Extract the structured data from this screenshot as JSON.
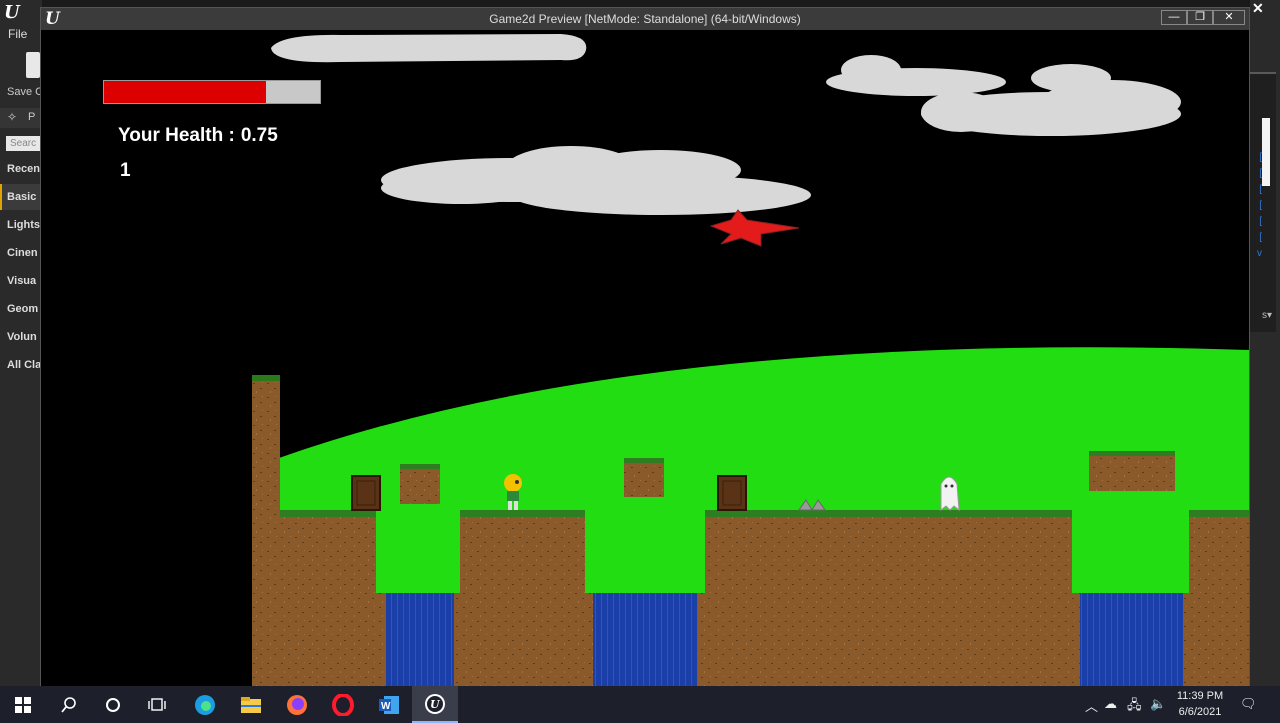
{
  "editor": {
    "file_menu": "File",
    "save_label": "Save C",
    "place_label": "P",
    "search_placeholder": "Searc",
    "categories": [
      "Recen",
      "Basic",
      "Lights",
      "Cinen",
      "Visua",
      "Geom",
      "Volun",
      "All Cla"
    ],
    "right_links": [
      "[",
      "[",
      "[",
      "[",
      "[",
      "[",
      "v"
    ],
    "right_bottom": "s▾"
  },
  "window": {
    "title": "Game2d Preview [NetMode: Standalone] (64-bit/Windows)",
    "minimize": "—",
    "maximize": "❐",
    "close": "✕"
  },
  "hud": {
    "health_label": "Your Health :",
    "health_value": "0.75",
    "health_fraction": 0.75,
    "score": "1",
    "health_color": "#dd0000"
  },
  "taskbar": {
    "apps": [
      "start-icon",
      "search-icon",
      "cortana-icon",
      "task-view-icon",
      "edge-icon",
      "file-explorer-icon",
      "firefox-icon",
      "opera-icon",
      "word-icon",
      "unreal-engine-icon"
    ],
    "time": "11:39 PM",
    "date": "6/6/2021"
  }
}
